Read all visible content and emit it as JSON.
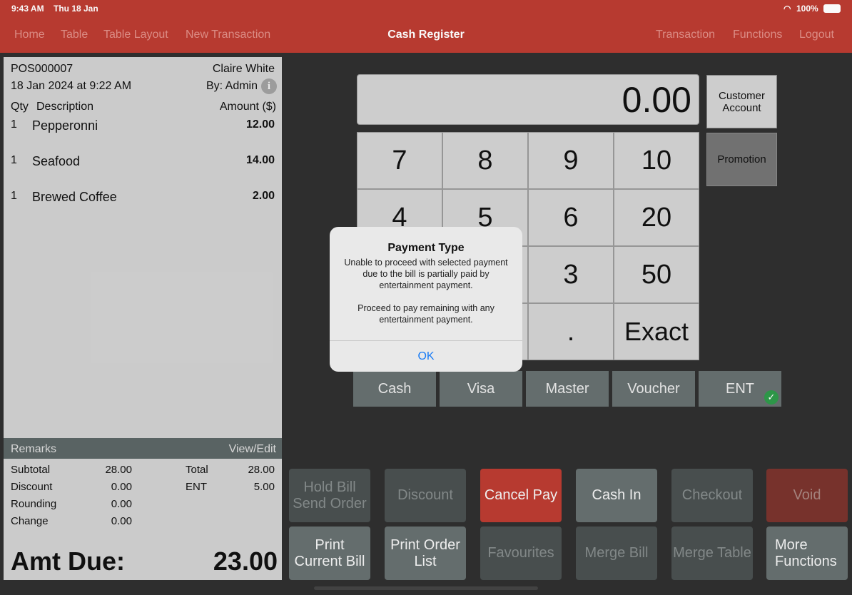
{
  "status_bar": {
    "time": "9:43 AM",
    "date": "Thu 18 Jan",
    "battery": "100%"
  },
  "nav": {
    "left": [
      "Home",
      "Table",
      "Table Layout",
      "New Transaction"
    ],
    "title": "Cash Register",
    "right": [
      "Transaction",
      "Functions",
      "Logout"
    ]
  },
  "receipt": {
    "number": "POS000007",
    "customer": "Claire White",
    "datetime": "18 Jan 2024 at 9:22 AM",
    "by": "By: Admin",
    "col_qty": "Qty",
    "col_desc": "Description",
    "col_amount": "Amount ($)",
    "items": [
      {
        "qty": "1",
        "desc": "Pepperonni",
        "amount": "12.00"
      },
      {
        "qty": "1",
        "desc": "Seafood",
        "amount": "14.00"
      },
      {
        "qty": "1",
        "desc": "Brewed Coffee",
        "amount": "2.00"
      }
    ],
    "remarks": "Remarks",
    "view_edit": "View/Edit",
    "subtotal_label": "Subtotal",
    "subtotal": "28.00",
    "discount_label": "Discount",
    "discount": "0.00",
    "rounding_label": "Rounding",
    "rounding": "0.00",
    "change_label": "Change",
    "change": "0.00",
    "total_label": "Total",
    "total": "28.00",
    "ent_label": "ENT",
    "ent": "5.00",
    "amt_due_label": "Amt Due:",
    "amt_due": "23.00"
  },
  "display": "0.00",
  "keys": [
    "7",
    "8",
    "9",
    "10",
    "4",
    "5",
    "6",
    "20",
    "",
    "",
    "3",
    "50",
    "",
    "",
    ".",
    "Exact"
  ],
  "side": {
    "customer_account": "Customer Account",
    "promotion": "Promotion"
  },
  "payments": [
    "Cash",
    "Visa",
    "Master",
    "Voucher",
    "ENT"
  ],
  "functions": [
    {
      "label": "Hold Bill\nSend Order",
      "state": "disabled"
    },
    {
      "label": "Discount",
      "state": "disabled"
    },
    {
      "label": "Cancel Pay",
      "state": "primary"
    },
    {
      "label": "Cash In",
      "state": "enabled"
    },
    {
      "label": "Checkout",
      "state": "disabled"
    },
    {
      "label": "Void",
      "state": "danger-disabled"
    },
    {
      "label": "Print\nCurrent Bill",
      "state": "enabled"
    },
    {
      "label": "Print Order\nList",
      "state": "enabled"
    },
    {
      "label": "Favourites",
      "state": "disabled"
    },
    {
      "label": "Merge Bill",
      "state": "disabled"
    },
    {
      "label": "Merge Table",
      "state": "disabled"
    },
    {
      "label": "More\nFunctions",
      "state": "enabled"
    }
  ],
  "modal": {
    "title": "Payment Type",
    "message": "Unable to proceed with selected payment due to the bill is partially paid by entertainment payment.\n\nProceed to pay remaining with any entertainment payment.",
    "ok": "OK"
  },
  "colors": {
    "brand": "#bb3c31",
    "check": "#2e9a4a"
  }
}
